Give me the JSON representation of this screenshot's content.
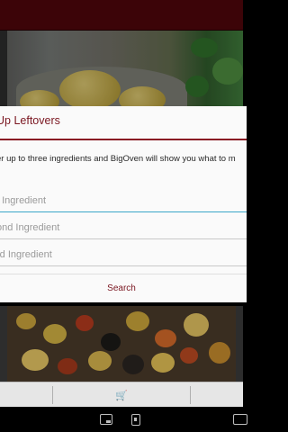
{
  "dialog": {
    "title": "Up Leftovers",
    "description": "er up to three ingredients and BigOven will show you what to m",
    "fields": [
      {
        "placeholder": "t Ingredient"
      },
      {
        "placeholder": "ond Ingredient"
      },
      {
        "placeholder": "rd Ingredient"
      }
    ],
    "search_label": "Search"
  },
  "tabbar": {
    "cart_icon": "shopping-cart-icon"
  },
  "navbar": {
    "icons": [
      "screen-icon",
      "phone-icon",
      "window-icon"
    ]
  },
  "colors": {
    "accent": "#7a1620",
    "topbar": "#3c0408",
    "focus": "#3aa7c9"
  }
}
